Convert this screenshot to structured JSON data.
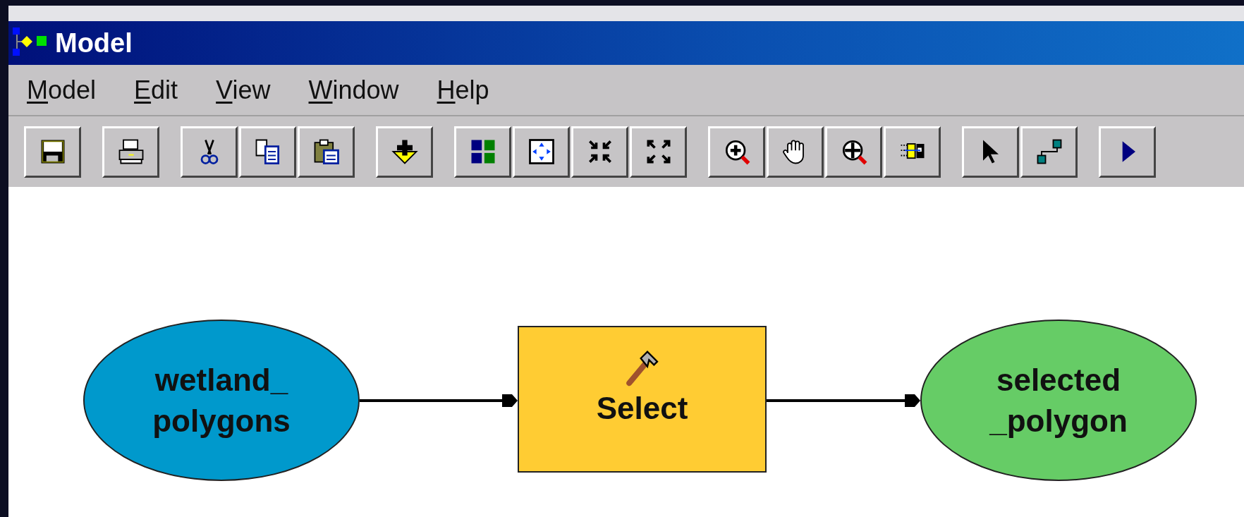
{
  "window": {
    "title": "Model"
  },
  "menu": [
    {
      "label": "Model"
    },
    {
      "label": "Edit"
    },
    {
      "label": "View"
    },
    {
      "label": "Window"
    },
    {
      "label": "Help"
    }
  ],
  "nodes": [
    {
      "kind": "data",
      "label": "wetland_\npolygons",
      "color": "#0099cc"
    },
    {
      "kind": "tool",
      "label": "Select",
      "color": "#ffcc33"
    },
    {
      "kind": "data",
      "label": "selected\n_polygon",
      "color": "#66cc66"
    }
  ]
}
